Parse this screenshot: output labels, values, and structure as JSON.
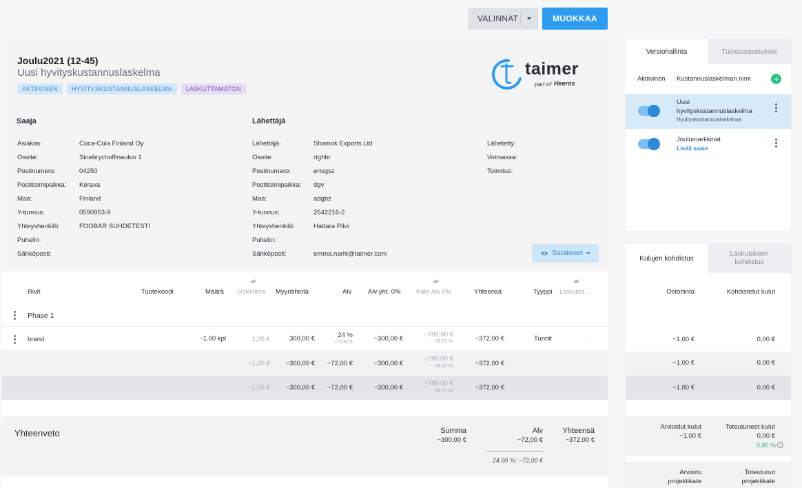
{
  "toolbar": {
    "valinnat_label": "VALINNAT",
    "muokkaa_label": "MUOKKAA"
  },
  "doc": {
    "title": "Joulu2021 (12-45)",
    "subtitle": "Uusi hyvityskustannuslaskelma",
    "badges": [
      "AKTIIVINEN",
      "HYVITYSKUSTANNUSLASKELMA",
      "LASKUTTAMATON"
    ],
    "logo_word": "taimer",
    "logo_tagline": "part of",
    "logo_brand": "Heeros"
  },
  "recipient": {
    "heading": "Saaja",
    "rows": [
      {
        "k": "Asiakas:",
        "v": "Coca-Cola Finland Oy"
      },
      {
        "k": "Osoite:",
        "v": "Sinebrychoffinaukio 1"
      },
      {
        "k": "Postinumero:",
        "v": "04250"
      },
      {
        "k": "Postitoimipaikka:",
        "v": "Kerava"
      },
      {
        "k": "Maa:",
        "v": "Finland"
      },
      {
        "k": "Y-tunnus:",
        "v": "0590953-9"
      },
      {
        "k": "Yhteyshenkilö:",
        "v": "FOOBAR SUHDETESTI"
      },
      {
        "k": "Puhelin:",
        "v": ""
      },
      {
        "k": "Sähköposti:",
        "v": ""
      }
    ]
  },
  "sender": {
    "heading": "Lähettäjä",
    "rows": [
      {
        "k": "Lähettäjä:",
        "v": "Shamok Exports Ltd"
      },
      {
        "k": "Osoite:",
        "v": "rtghbr"
      },
      {
        "k": "Postinumero:",
        "v": "ertsgsz"
      },
      {
        "k": "Postitoimipaikka:",
        "v": "dgv"
      },
      {
        "k": "Maa:",
        "v": "adgbz"
      },
      {
        "k": "Y-tunnus:",
        "v": "2542216-2"
      },
      {
        "k": "Yhteyshenkilö:",
        "v": "Hattara Pilvi"
      },
      {
        "k": "Puhelin:",
        "v": ""
      },
      {
        "k": "Sähköposti:",
        "v": "emma.narhi@taimer.com"
      }
    ]
  },
  "meta": {
    "rows": [
      "Lähetetty:",
      "Voimassa:",
      "Toimitus:"
    ]
  },
  "sarakkeet_label": "Sarakkeet",
  "table": {
    "headers": {
      "rivit": "Rivit",
      "tuotekoodi": "Tuotekoodi",
      "maara": "Määrä",
      "ostohinta": "Ostohinta",
      "myyntihinta": "Myyntihinta",
      "alv": "Alv",
      "alv_yht": "Alv yht. 0%",
      "kate_alv": "Kate Alv 0%",
      "yhteensa": "Yhteensä",
      "tyyppi": "Tyyppi",
      "laskutettu": "Laskutet..."
    },
    "phase": "Phase 1",
    "item": {
      "name": "brand",
      "maara": "-1.00 kpl",
      "ostohinta": "1,00 €",
      "myyntihinta": "300,00 €",
      "alv": "24 %",
      "alv_sub": "−72,00 €",
      "alv_yht": "−300,00 €",
      "kate": "−299,00 €",
      "kate_sub": "99.67 %",
      "yhteensa": "−372,00 €",
      "tyyppi": "Tunnit",
      "laskutettu": "-"
    },
    "subtotal": {
      "ostohinta": "−1,00 €",
      "myyntihinta": "−300,00 €",
      "alv": "−72,00 €",
      "alv_yht": "−300,00 €",
      "kate": "−299,00 €",
      "kate_sub": "99.67 %",
      "yhteensa": "−372,00 €"
    },
    "total": {
      "ostohinta": "−1,00 €",
      "myyntihinta": "−300,00 €",
      "alv": "−72,00 €",
      "alv_yht": "−300,00 €",
      "kate": "−299,00 €",
      "kate_sub": "99.67 %",
      "yhteensa": "−372,00 €"
    }
  },
  "summary": {
    "heading": "Yhteenveto",
    "summa_label": "Summa",
    "summa_value": "−300,00 €",
    "alv_label": "Alv",
    "alv_value": "−72,00 €",
    "yhteensa_label": "Yhteensä",
    "yhteensa_value": "−372,00 €",
    "vat_breakdown": "24.00 %:  −72,00 €"
  },
  "version_panel": {
    "tabs": [
      "Versiohallinta",
      "Tulostusasetukset"
    ],
    "col_active": "Aktiivinen",
    "col_name": "Kustannuslaskelman nimi",
    "items": [
      {
        "title_line1": "Uusi",
        "title_line2": "hyvityskustannuslaskelma",
        "sub": "Hyvityskustannuslaskelma"
      },
      {
        "title_line1": "Joulumarkkinat",
        "sub": "Lisää saate"
      }
    ]
  },
  "cost_panel": {
    "tabs": [
      "Kulujen kohdistus",
      "Laskutuksen kohdistus"
    ],
    "col_ostohinta": "Ostohinta",
    "col_kohdistetut": "Kohdistetut kulut",
    "rows": [
      {
        "ostohinta": "−1,00 €",
        "kohdistetut": "0,00 €"
      },
      {
        "ostohinta": "−1,00 €",
        "kohdistetut": "0,00 €"
      },
      {
        "ostohinta": "−1,00 €",
        "kohdistetut": "0,00 €"
      }
    ],
    "arvioidut_label": "Arvioidut kulut",
    "arvioidut_value": "−1,00 €",
    "toteutuneet_label": "Toteutuneet kulut",
    "toteutuneet_value": "0,00 €",
    "toteutuneet_pct": "0.00 %",
    "arvioitu_label1": "Arvioitu",
    "arvioitu_label2": "projektikate",
    "toteutunut_label1": "Toteutunut",
    "toteutunut_label2": "projektikate"
  },
  "colors": {
    "accent": "#2d9cf0",
    "badge_blue": "#d3e7fb",
    "badge_purple": "#e6dcf5",
    "green": "#2bb673",
    "selected_row": "#d7eaf9"
  }
}
